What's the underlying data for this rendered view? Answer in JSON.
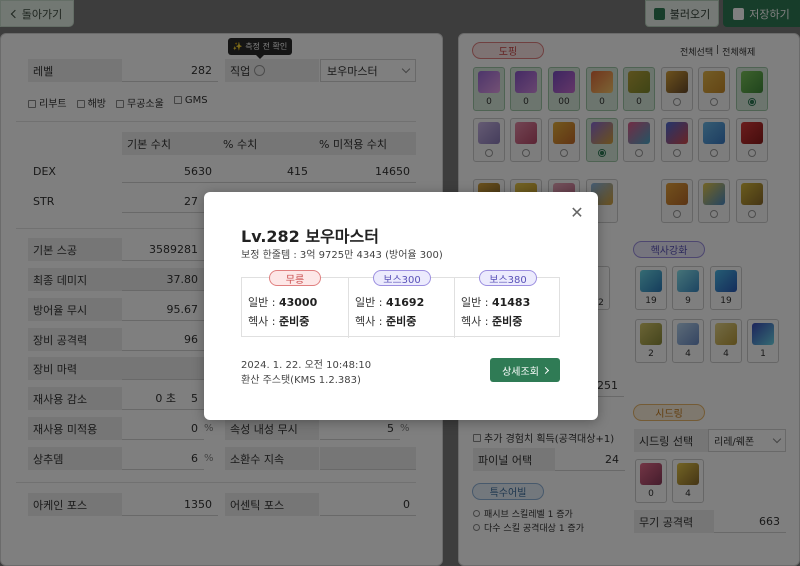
{
  "toolbar": {
    "back_label": "돌아가기",
    "load_label": "불러오기",
    "save_label": "저장하기"
  },
  "left": {
    "tooltip": "✨ 측정 전 확인",
    "level_label": "레벨",
    "level_value": "282",
    "job_label": "직업",
    "job_value": "보우마스터",
    "options": [
      "리부트",
      "해방",
      "무공소울",
      "GMS"
    ],
    "table_headers": [
      "기본 수치",
      "% 수치",
      "% 미적용 수치"
    ],
    "dex_label": "DEX",
    "dex_base": "5630",
    "dex_pct": "415",
    "dex_flat": "14650",
    "str_label": "STR",
    "str_base": "27",
    "base_stat_label": "기본 스공",
    "base_stat_value": "3589281",
    "final_dmg_label": "최종 데미지",
    "final_dmg_value": "37.80",
    "ignore_def_label": "방어율 무시",
    "ignore_def_value": "95.67",
    "equip_atk_label": "장비 공격력",
    "equip_atk_value": "96",
    "equip_mag_label": "장비 마력",
    "cooldown_label": "재사용 감소",
    "cooldown_value": "0 초",
    "cooldown_value2": "5",
    "cooldown_na_label": "재사용 미적용",
    "cooldown_na_value": "0",
    "status_label": "상추뎀",
    "status_value": "6",
    "pct": "%",
    "ele_ignore_label": "속성 내성 무시",
    "ele_ignore_value": "5",
    "summon_label": "소환수 지속",
    "arcane_label": "아케인 포스",
    "arcane_value": "1350",
    "authentic_label": "어센틱 포스",
    "authentic_value": "0"
  },
  "right": {
    "doping_tag": "도핑",
    "select_all": "전체선택",
    "divider": "|",
    "deselect_all": "전체해제",
    "doping_nums": [
      "0",
      "0",
      "00",
      "0",
      "0"
    ],
    "hexa_tag": "헥사강화",
    "hexa_row1": [
      "19",
      "9",
      "19"
    ],
    "hexa_row2": [
      "2",
      "4",
      "4",
      "1"
    ],
    "partial_num": "2",
    "partial_val": "251",
    "extra_exp": "추가 경험치 획득(공격대상+1)",
    "final_attack_label": "파이널 어택",
    "final_attack_value": "24",
    "special_tag": "특수어빌",
    "special_items": [
      "패시브 스킬레벨 1 증가",
      "다수 스킬 공격대상 1 증가"
    ],
    "seed_tag": "시드링",
    "seed_select_label": "시드링 선택",
    "seed_select_value": "리레/웨폰",
    "seed_nums": [
      "0",
      "4"
    ],
    "weapon_atk_label": "무기 공격력",
    "weapon_atk_value": "663"
  },
  "modal": {
    "title": "Lv.282 보우마스터",
    "subtitle": "보정 한줄템 : 3억 9725만 4343 (방어율 300)",
    "columns": [
      {
        "tag": "무릉",
        "normal_label": "일반 :",
        "normal_value": "43000",
        "hexa_label": "헥사 :",
        "hexa_value": "준비중"
      },
      {
        "tag": "보스300",
        "normal_label": "일반 :",
        "normal_value": "41692",
        "hexa_label": "헥사 :",
        "hexa_value": "준비중"
      },
      {
        "tag": "보스380",
        "normal_label": "일반 :",
        "normal_value": "41483",
        "hexa_label": "헥사 :",
        "hexa_value": "준비중"
      }
    ],
    "date": "2024. 1. 22. 오전 10:48:10",
    "version": "환산 주스탯(KMS 1.2.383)",
    "detail_label": "상세조회",
    "close_icon": "close-icon"
  },
  "colors": {
    "accent": "#2f7b55",
    "overlay": "rgba(0,0,0,0.5)"
  }
}
